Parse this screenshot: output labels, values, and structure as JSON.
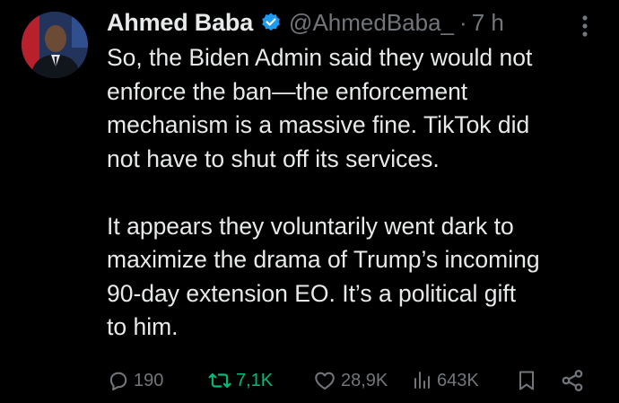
{
  "author": {
    "name": "Ahmed Baba",
    "handle": "@AhmedBaba_",
    "separator": "·",
    "time": "7 h",
    "verified_color": "#1d9bf0"
  },
  "tweet": {
    "paragraphs": [
      "So, the Biden Admin said they would not\nenforce the ban—the enforcement\nmechanism is a massive fine. TikTok did\nnot have to shut off its services.",
      "It appears they voluntarily went dark to\nmaximize the drama of Trump’s incoming\n90-day extension EO. It’s a political gift\nto him."
    ]
  },
  "actions": {
    "replies": "190",
    "reposts": "7,1K",
    "likes": "28,9K",
    "views": "643K",
    "repost_color": "#00ba7c"
  },
  "icons": {
    "avatar": "profile-photo",
    "verified": "verified-badge-icon",
    "more": "more-vertical-icon",
    "reply": "reply-icon",
    "repost": "repost-icon",
    "like": "heart-icon",
    "views": "views-icon",
    "bookmark": "bookmark-icon",
    "share": "share-icon"
  }
}
